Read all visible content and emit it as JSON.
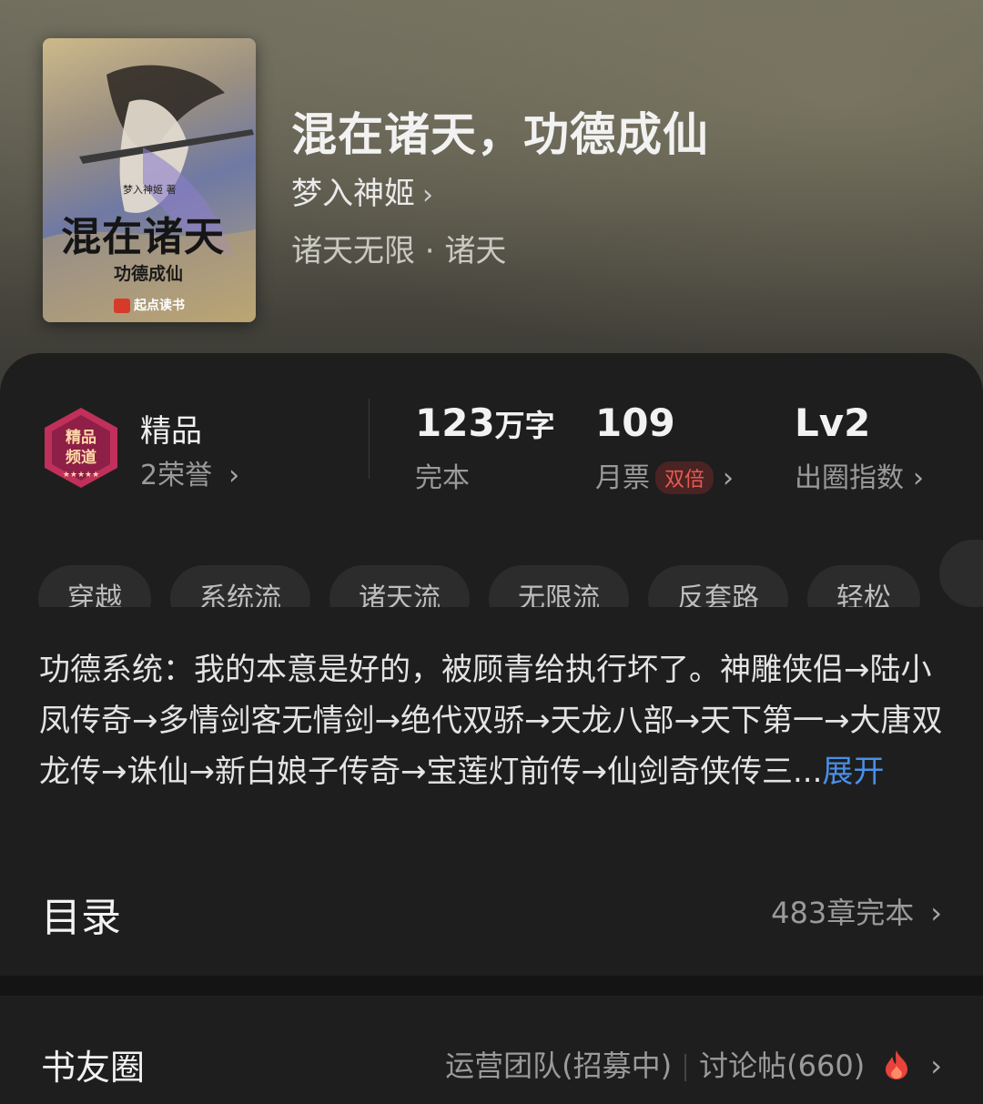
{
  "book": {
    "title": "混在诸天，功德成仙",
    "author": "梦入神姬",
    "genre": "诸天无限 · 诸天",
    "author_chevron": "›"
  },
  "cover": {
    "title": "混在诸天",
    "subtitle": "功德成仙",
    "author": "梦入神姬 著",
    "publisher": "起点读书"
  },
  "quality": {
    "title": "精品",
    "honors": "2荣誉",
    "chevron": "›"
  },
  "stats": {
    "words_value": "123",
    "words_unit": "万字",
    "words_label": "完本",
    "votes_value": "109",
    "votes_label": "月票",
    "votes_badge": "双倍",
    "level_value": "Lv2",
    "level_label": "出圈指数",
    "chevron": "›"
  },
  "tags": [
    "穿越",
    "系统流",
    "诸天流",
    "无限流",
    "反套路",
    "轻松"
  ],
  "synopsis": {
    "text": "功德系统：我的本意是好的，被顾青给执行坏了。神雕侠侣→陆小凤传奇→多情剑客无情剑→绝代双骄→天龙八部→天下第一→大唐双龙传→诛仙→新白娘子传奇→宝莲灯前传→仙剑奇侠传三...",
    "expand": "展开"
  },
  "toc": {
    "title": "目录",
    "summary": "483章完本",
    "chevron": "›"
  },
  "circle": {
    "title": "书友圈",
    "team": "运营团队(招募中)",
    "posts": "讨论帖(660)",
    "chevron": "›"
  },
  "colors": {
    "accent_blue": "#4a8fe8",
    "badge_red": "#e85a52",
    "fire": "#e8423a"
  },
  "icons": {
    "badge": "premium-channel-badge-icon",
    "fire": "fire-icon",
    "chevron": "chevron-right-icon"
  }
}
